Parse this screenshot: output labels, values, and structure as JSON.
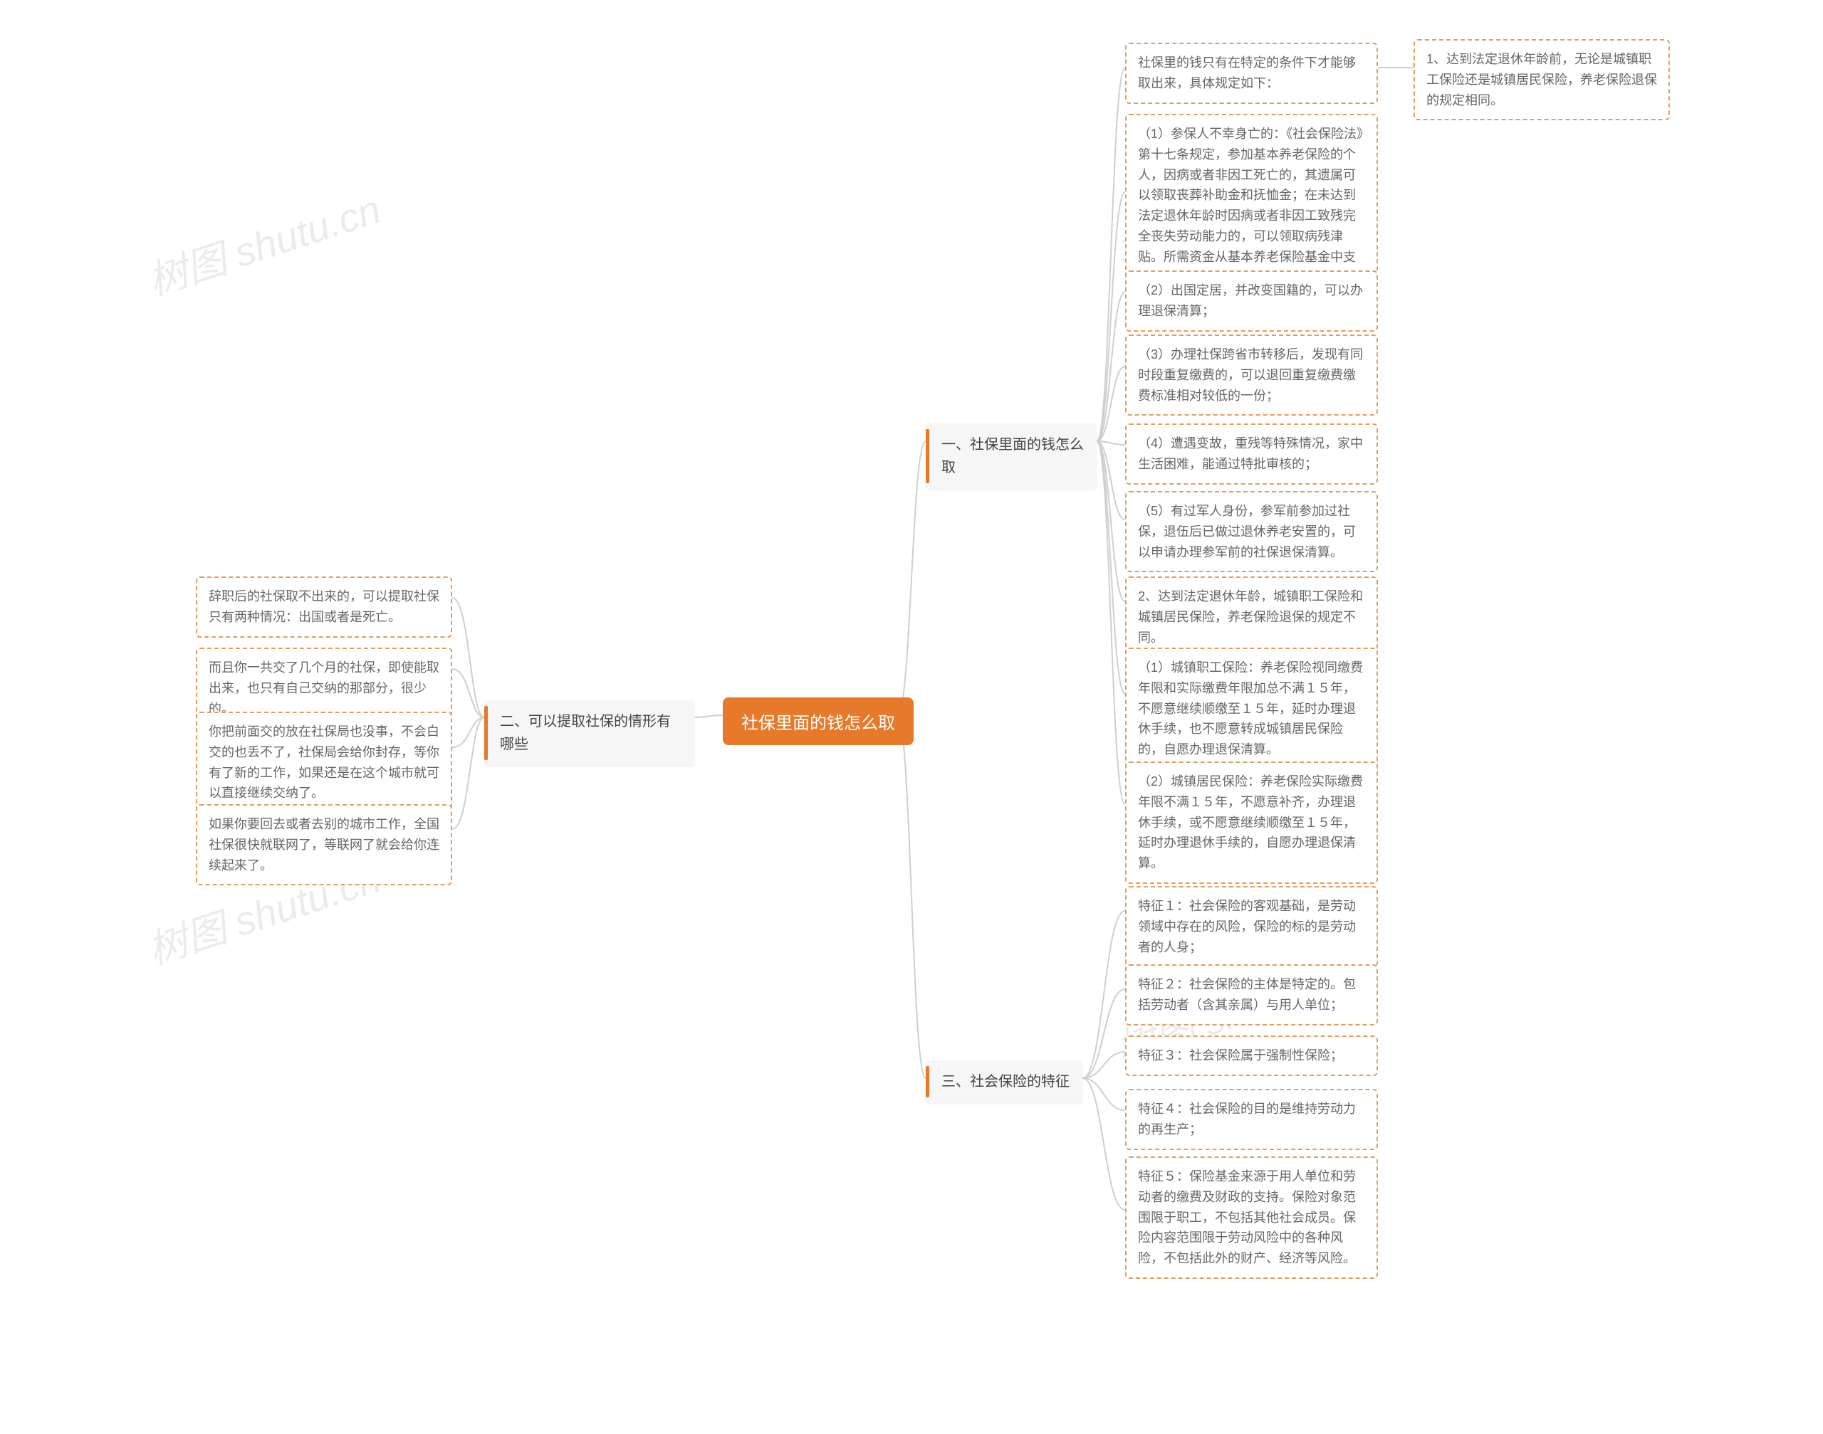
{
  "watermark": "树图 shutu.cn",
  "root": "社保里面的钱怎么取",
  "section1": {
    "title": "一、社保里面的钱怎么取",
    "intro": "社保里的钱只有在特定的条件下才能够取出来，具体规定如下：",
    "intro_child": "1、达到法定退休年龄前，无论是城镇职工保险还是城镇居民保险，养老保险退保的规定相同。",
    "c1": "（1）参保人不幸身亡的：《社会保险法》第十七条规定，参加基本养老保险的个人，因病或者非因工死亡的，其遗属可以领取丧葬补助金和抚恤金；在未达到法定退休年龄时因病或者非因工致残完全丧失劳动能力的，可以领取病残津贴。所需资金从基本养老保险基金中支付。",
    "c2": "（2）出国定居，并改变国籍的，可以办理退保清算；",
    "c3": "（3）办理社保跨省市转移后，发现有同时段重复缴费的，可以退回重复缴费缴费标准相对较低的一份；",
    "c4": "（4）遭遇变故，重残等特殊情况，家中生活困难，能通过特批审核的；",
    "c5": "（5）有过军人身份，参军前参加过社保，退伍后已做过退休养老安置的，可以申请办理参军前的社保退保清算。",
    "m2": "2、达到法定退休年龄，城镇职工保险和城镇居民保险，养老保险退保的规定不同。",
    "m2a": "（1）城镇职工保险：养老保险视同缴费年限和实际缴费年限加总不满１５年，不愿意继续顺缴至１５年，延时办理退休手续，也不愿意转成城镇居民保险的，自愿办理退保清算。",
    "m2b": "（2）城镇居民保险：养老保险实际缴费年限不满１５年，不愿意补齐，办理退休手续，或不愿意继续顺缴至１５年，延时办理退休手续的，自愿办理退保清算。"
  },
  "section2": {
    "title": "二、可以提取社保的情形有哪些",
    "l1": "辞职后的社保取不出来的，可以提取社保只有两种情况：出国或者是死亡。",
    "l2": "而且你一共交了几个月的社保，即使能取出来，也只有自己交纳的那部分，很少的。",
    "l3": "你把前面交的放在社保局也没事，不会白交的也丢不了，社保局会给你封存，等你有了新的工作，如果还是在这个城市就可以直接继续交纳了。",
    "l4": "如果你要回去或者去别的城市工作，全国社保很快就联网了，等联网了就会给你连续起来了。"
  },
  "section3": {
    "title": "三、社会保险的特征",
    "a": "特征１：社会保险的客观基础，是劳动领域中存在的风险，保险的标的是劳动者的人身；",
    "b": "特征２：社会保险的主体是特定的。包括劳动者（含其亲属）与用人单位；",
    "c": "特征３：社会保险属于强制性保险；",
    "d": "特征４：社会保险的目的是维持劳动力的再生产；",
    "e": "特征５：保险基金来源于用人单位和劳动者的缴费及财政的支持。保险对象范围限于职工，不包括其他社会成员。保险内容范围限于劳动风险中的各种风险，不包括此外的财产、经济等风险。"
  }
}
